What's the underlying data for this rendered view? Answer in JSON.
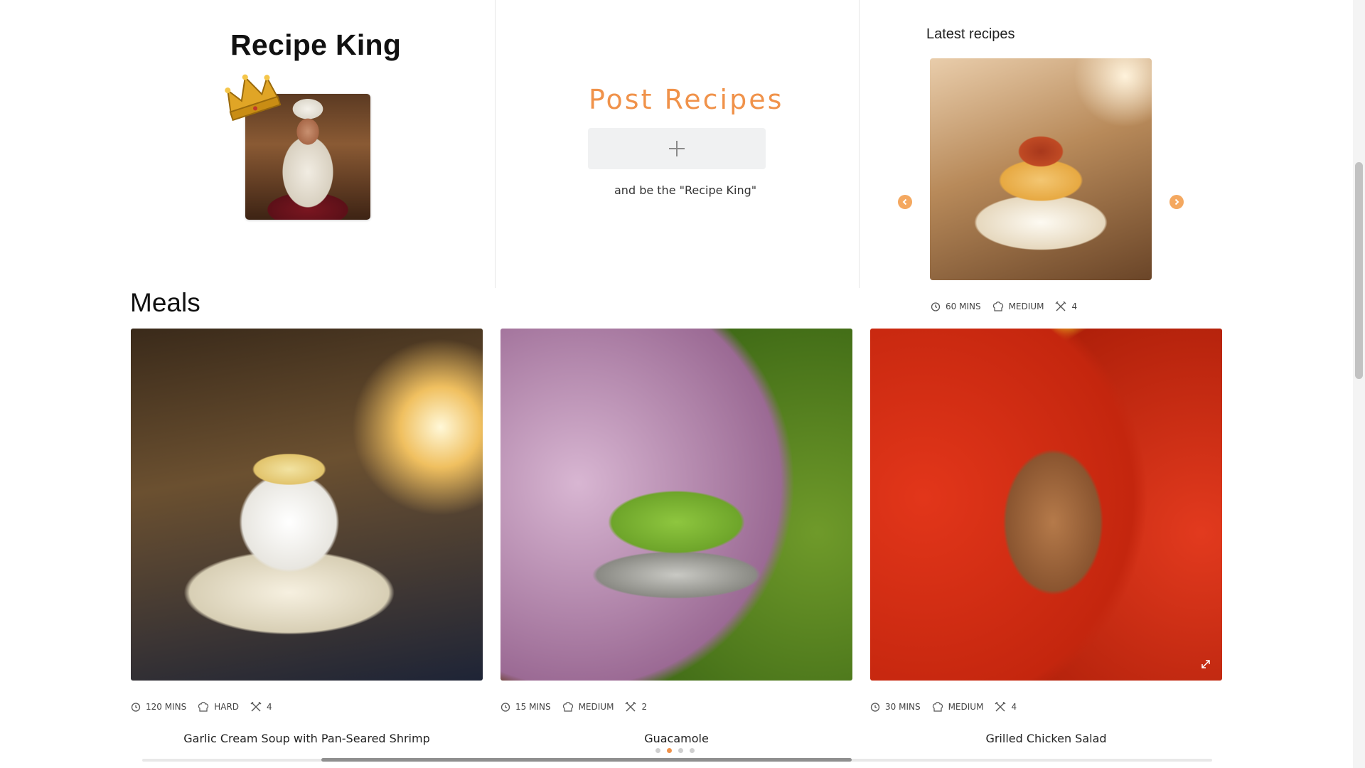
{
  "header": {
    "site_title": "Recipe King",
    "logo_icon": "crown-icon"
  },
  "post": {
    "title": "Post Recipes",
    "add_icon": "plus-icon",
    "subtitle": "and be the \"Recipe King\""
  },
  "latest": {
    "title": "Latest recipes",
    "time": "60 MINS",
    "difficulty": "MEDIUM",
    "servings": "4"
  },
  "meals": {
    "title": "Meals",
    "cards": [
      {
        "time": "120 MINS",
        "difficulty": "HARD",
        "servings": "4",
        "name": "Garlic Cream Soup with Pan-Seared Shrimp"
      },
      {
        "time": "15 MINS",
        "difficulty": "MEDIUM",
        "servings": "2",
        "name": "Guacamole"
      },
      {
        "time": "30 MINS",
        "difficulty": "MEDIUM",
        "servings": "4",
        "name": "Grilled Chicken Salad"
      }
    ],
    "pagination": {
      "pages": 4,
      "active": 2
    }
  },
  "colors": {
    "accent": "#f0924a",
    "arrow": "#f4a860",
    "divider": "#e6e6e6"
  }
}
